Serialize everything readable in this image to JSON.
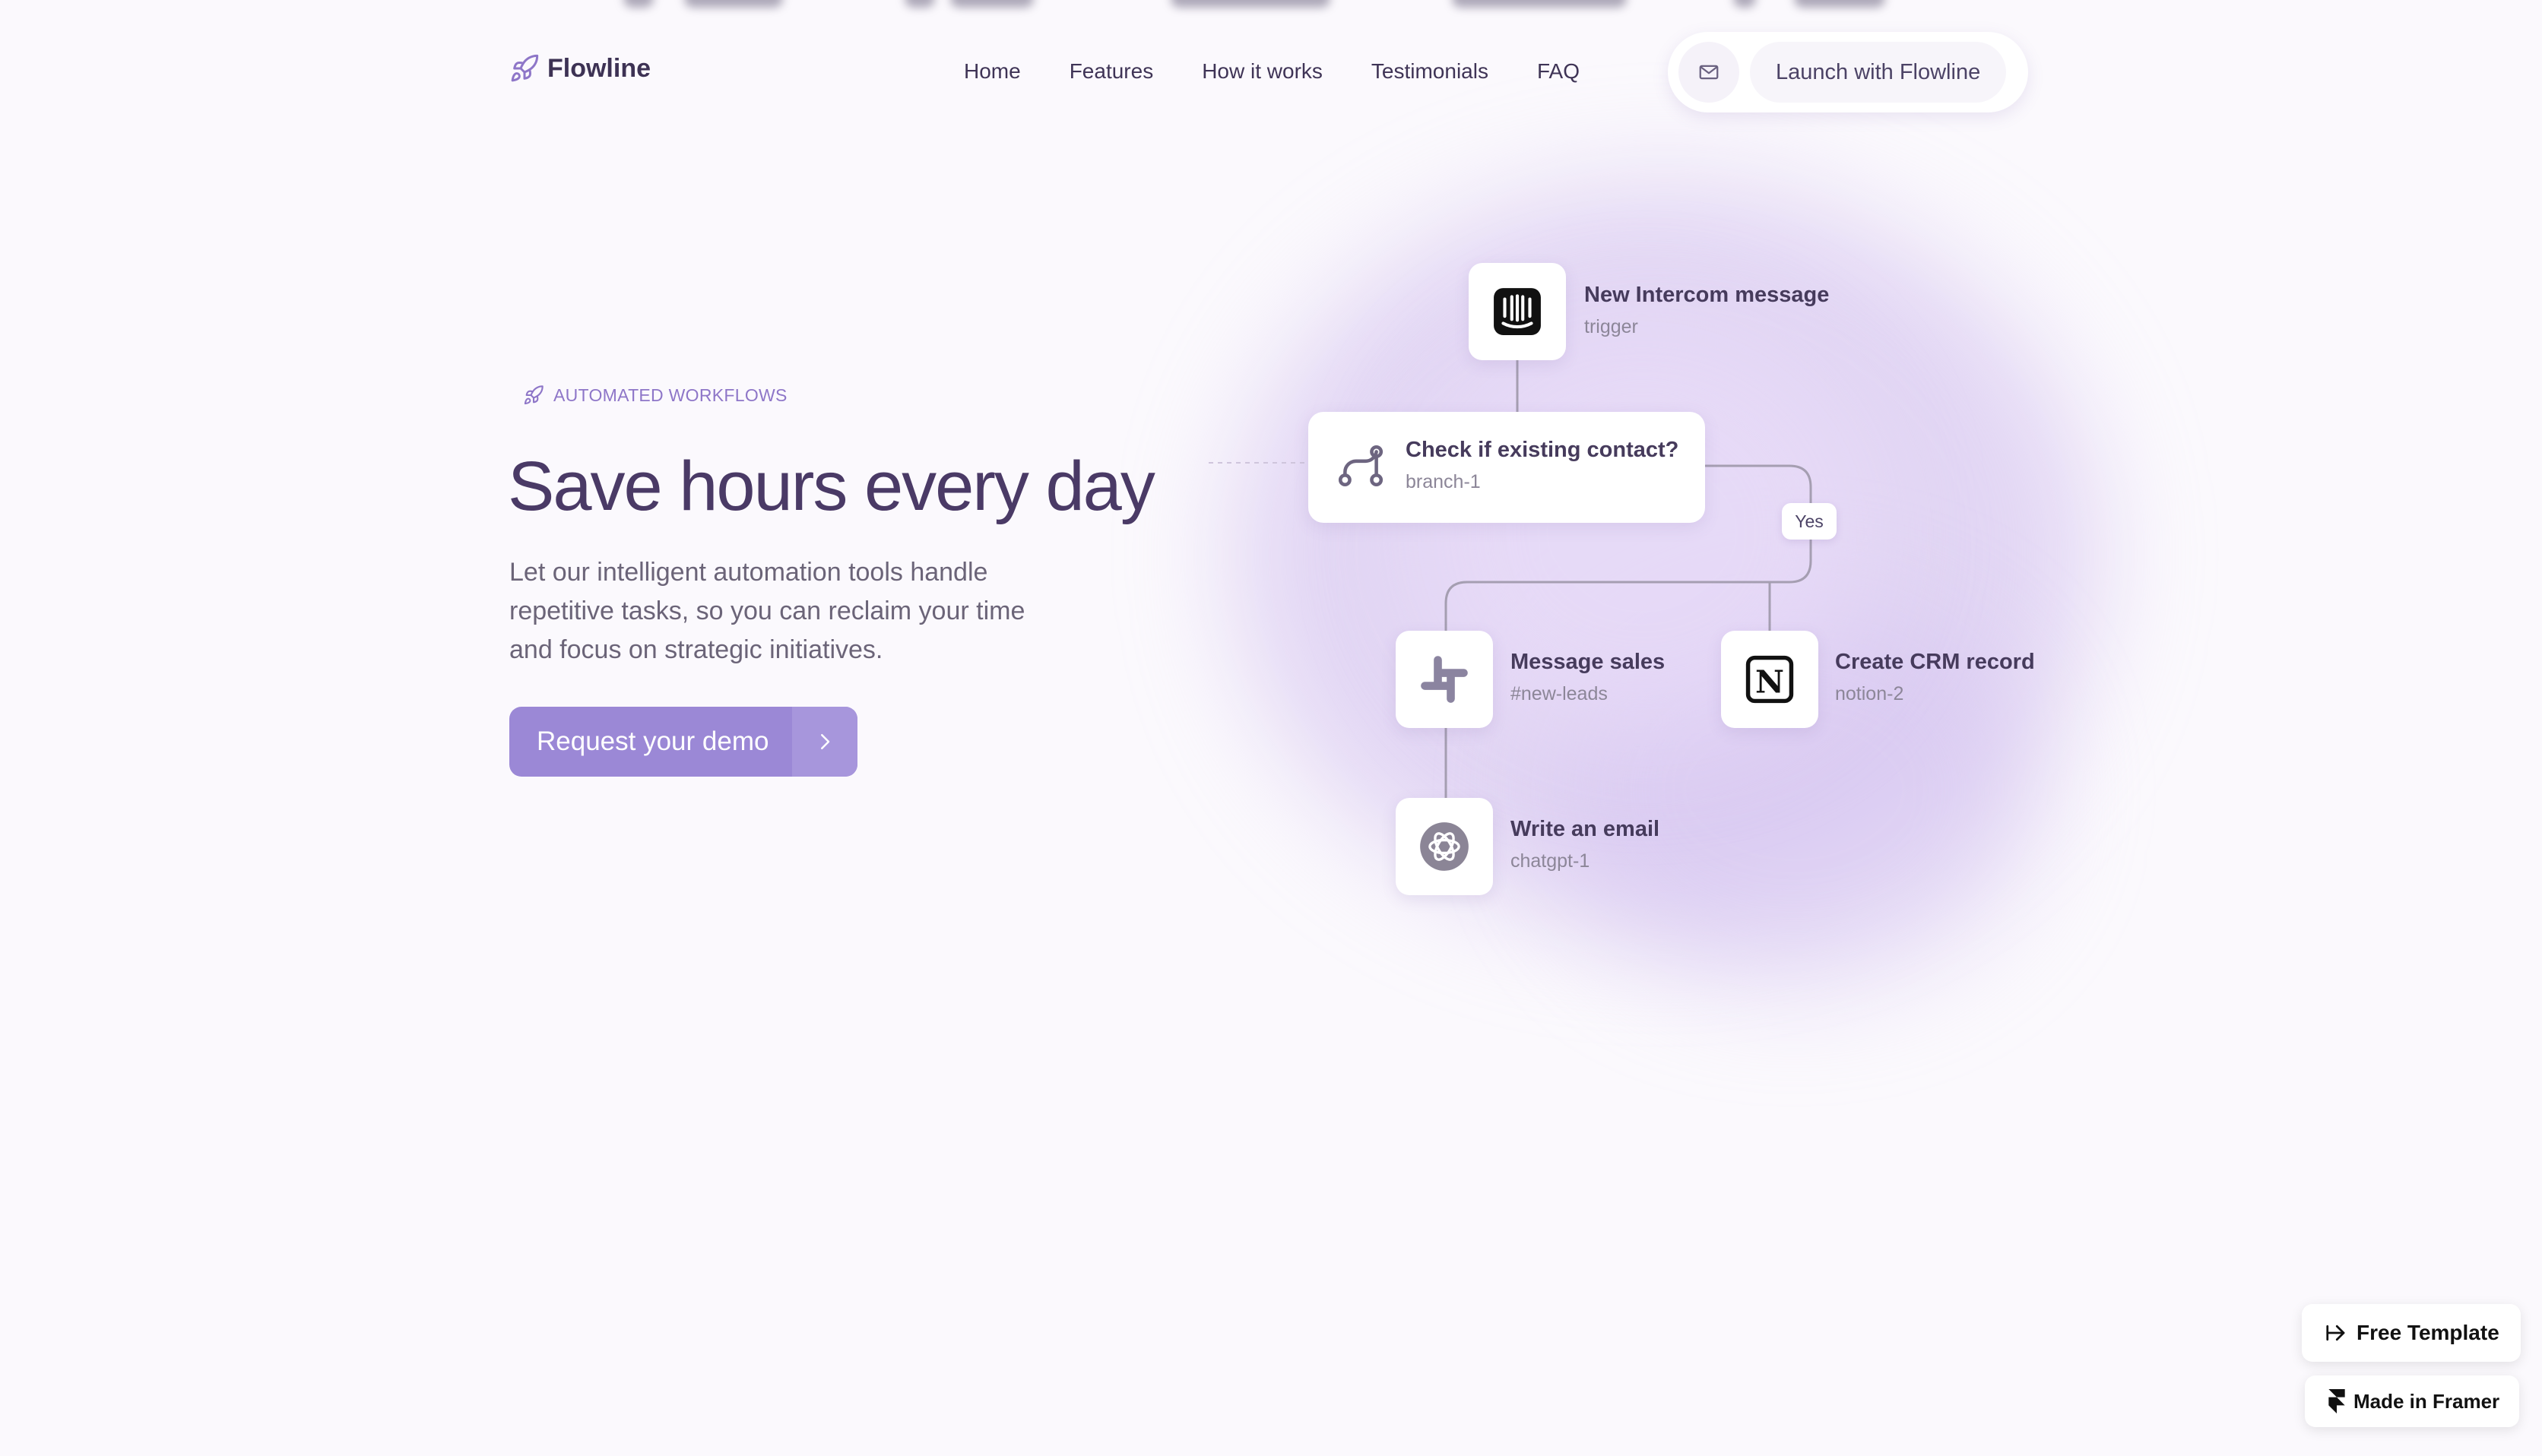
{
  "brand": {
    "name": "Flowline",
    "accent": "#9b88d6",
    "heading_color": "#4a3a66"
  },
  "nav": {
    "items": [
      {
        "label": "Home"
      },
      {
        "label": "Features"
      },
      {
        "label": "How it works"
      },
      {
        "label": "Testimonials"
      },
      {
        "label": "FAQ"
      }
    ],
    "mail_icon": "mail-icon",
    "cta_label": "Launch with Flowline"
  },
  "hero": {
    "eyebrow": "AUTOMATED WORKFLOWS",
    "title": "Save hours every day",
    "subtitle": "Let our intelligent automation tools handle repetitive tasks, so you can reclaim your time and focus on strategic initiatives.",
    "button_label": "Request your demo"
  },
  "workflow": {
    "trigger": {
      "title": "New Intercom message",
      "subtitle": "trigger",
      "icon": "intercom-icon"
    },
    "branch": {
      "title": "Check if existing contact?",
      "subtitle": "branch-1",
      "icon": "branch-icon"
    },
    "condition_label": "Yes",
    "slack": {
      "title": "Message sales",
      "subtitle": "#new-leads",
      "icon": "slack-icon"
    },
    "notion": {
      "title": "Create CRM record",
      "subtitle": "notion-2",
      "icon": "notion-icon"
    },
    "chatgpt": {
      "title": "Write an email",
      "subtitle": "chatgpt-1",
      "icon": "chatgpt-icon"
    }
  },
  "badges": {
    "free_template": "Free Template",
    "made_in_framer": "Made in Framer"
  }
}
